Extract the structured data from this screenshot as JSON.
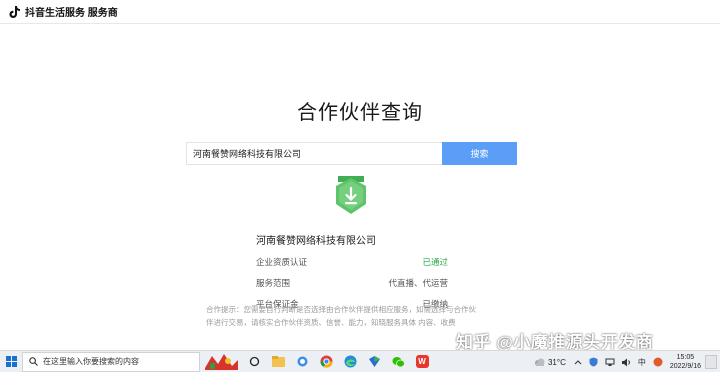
{
  "header": {
    "brand": "抖音生活服务 服务商"
  },
  "main": {
    "title": "合作伙伴查询",
    "search": {
      "value": "河南餐赞网络科技有限公司",
      "button_label": "搜索"
    },
    "result": {
      "company_name": "河南餐赞网络科技有限公司",
      "rows": [
        {
          "label": "企业资质认证",
          "value": "已通过"
        },
        {
          "label": "服务范围",
          "value": "代直播、代运营"
        },
        {
          "label": "平台保证金",
          "value": "已缴纳"
        }
      ]
    },
    "hint_line1": "合作提示：您需要自行判断是否选择由合作伙伴提供相应服务，如需选择与合作伙",
    "hint_line2": "伴进行交易，请核实合作伙伴资质、信誉、能力，知晓服务具体 内容、收费"
  },
  "watermark": "知乎 @小魔推源头开发商",
  "taskbar": {
    "search_placeholder": "在这里输入你要搜索的内容",
    "weather": "31°C",
    "ime": "中",
    "time": "15:05",
    "date": "2022/9/16",
    "icons": [
      "start-icon",
      "task-view-icon",
      "file-explorer-icon",
      "chat-icon",
      "chrome-icon",
      "edge-icon",
      "app-icon",
      "wechat-icon",
      "wps-icon"
    ]
  },
  "colors": {
    "accent_blue": "#5b9ef7",
    "status_green": "#2aa84a",
    "badge_green": "#5ec46b"
  }
}
